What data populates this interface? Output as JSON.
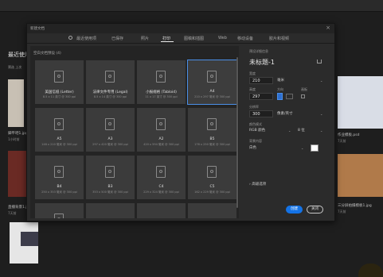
{
  "background": {
    "section_title": "最近使用",
    "sub_labels": "筛选  上次",
    "files": [
      {
        "name": "脚平吧1.jpg",
        "meta": "1小时前"
      },
      {
        "name": "直播背景1.jpg",
        "meta": "7天前"
      },
      {
        "name": "作业模板.psd",
        "meta": "7天前"
      },
      {
        "name": "三分屏拍摄模板1.jpg",
        "meta": "7天前"
      }
    ]
  },
  "dialog": {
    "title": "新建文档",
    "close_label": "×",
    "tabs": [
      {
        "label": "最近使用项"
      },
      {
        "label": "已保存"
      },
      {
        "label": "照片"
      },
      {
        "label": "打印"
      },
      {
        "label": "图稿和插图"
      },
      {
        "label": "Web"
      },
      {
        "label": "移动设备"
      },
      {
        "label": "胶片和视频"
      }
    ],
    "active_tab": "打印",
    "presets_header": "空白文档预设 (4)",
    "presets": [
      {
        "name": "美国信纸 (Letter)",
        "size": "8.5 x 11 英寸 @ 300 ppi"
      },
      {
        "name": "法律文件专用 (Legal)",
        "size": "8.5 x 14 英寸 @ 300 ppi"
      },
      {
        "name": "小报规格 (Tabloid)",
        "size": "11 x 17 英寸 @ 300 ppi"
      },
      {
        "name": "A4",
        "size": "210 x 297 毫米 @ 300 ppi"
      },
      {
        "name": "A5",
        "size": "148 x 210 毫米 @ 300 ppi"
      },
      {
        "name": "A3",
        "size": "297 x 420 毫米 @ 300 ppi"
      },
      {
        "name": "A2",
        "size": "420 x 594 毫米 @ 300 ppi"
      },
      {
        "name": "B5",
        "size": "176 x 250 毫米 @ 300 ppi"
      },
      {
        "name": "B4",
        "size": "250 x 353 毫米 @ 300 ppi"
      },
      {
        "name": "B3",
        "size": "353 x 500 毫米 @ 300 ppi"
      },
      {
        "name": "C4",
        "size": "229 x 324 毫米 @ 300 ppi"
      },
      {
        "name": "C5",
        "size": "162 x 229 毫米 @ 300 ppi"
      },
      {
        "name": "",
        "size": ""
      },
      {
        "name": "",
        "size": ""
      },
      {
        "name": "",
        "size": ""
      },
      {
        "name": "",
        "size": ""
      }
    ],
    "selected_preset": "A4",
    "details": {
      "header": "预设详细信息",
      "doc_name": "未标题-1",
      "width_label": "宽度",
      "width_value": "210",
      "width_unit": "毫米",
      "height_label": "高度",
      "orientation_label": "方向",
      "artboards_label": "画板",
      "height_value": "297",
      "resolution_label": "分辨率",
      "resolution_value": "300",
      "resolution_unit": "像素/英寸",
      "color_mode_label": "颜色模式",
      "color_mode_value": "RGB 颜色",
      "bit_depth_value": "8 位",
      "background_label": "背景内容",
      "background_value": "白色",
      "background_color": "#ffffff",
      "advanced_label": "高级选项",
      "create_label": "创建",
      "close_label": "关闭"
    }
  }
}
